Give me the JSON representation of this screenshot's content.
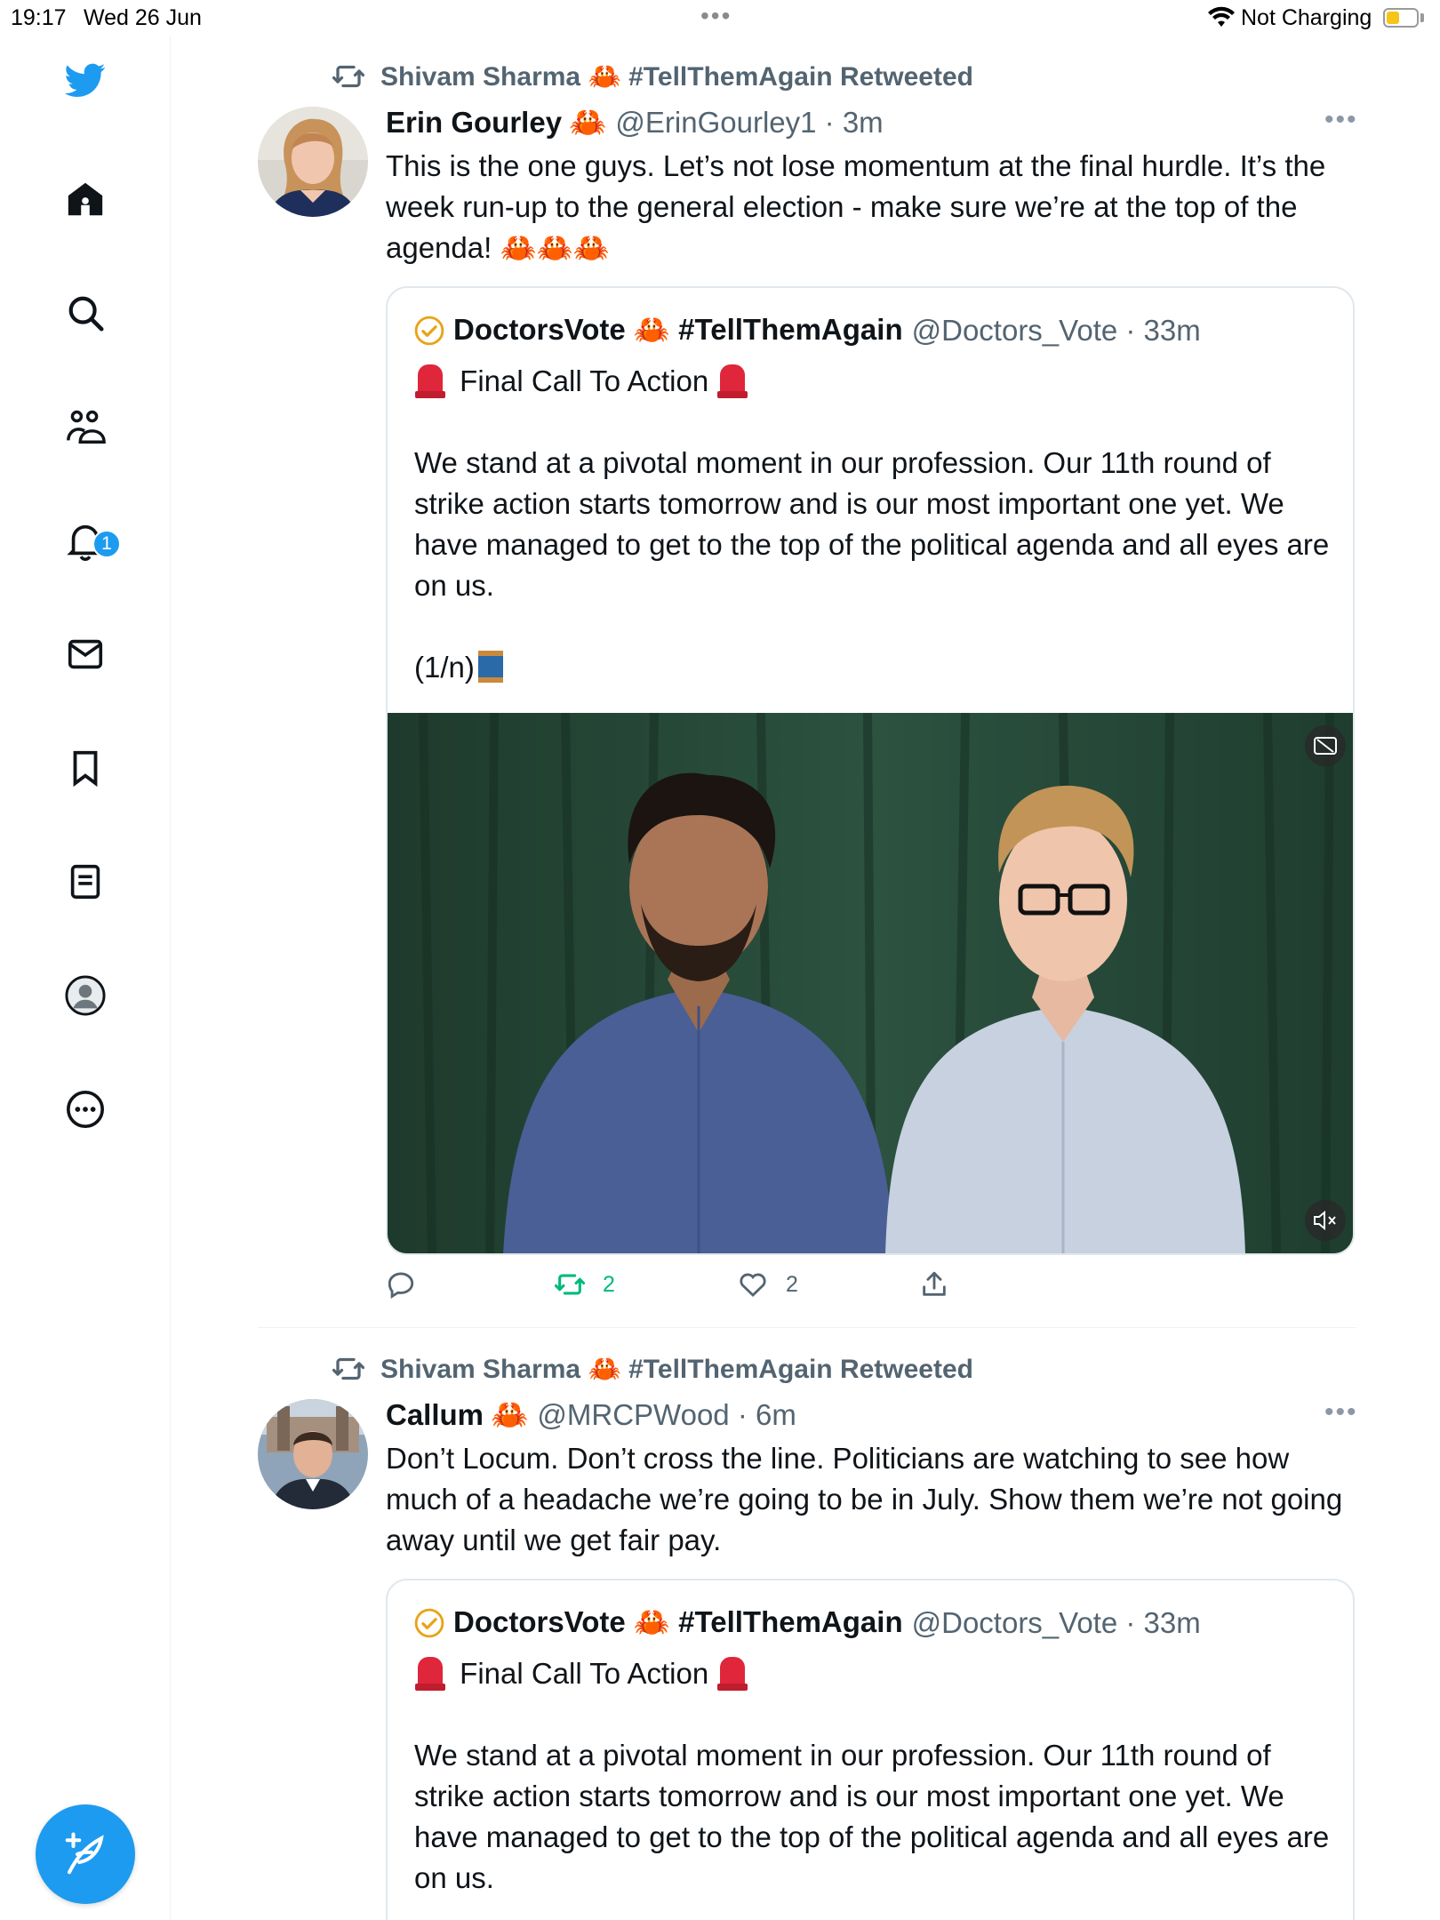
{
  "status_bar": {
    "time": "19:17",
    "date": "Wed 26 Jun",
    "charging": "Not Charging",
    "battery_level": 0.45
  },
  "sidebar": {
    "notification_count": "1",
    "items": [
      {
        "icon": "twitter-bird-icon"
      },
      {
        "icon": "home-icon"
      },
      {
        "icon": "search-icon"
      },
      {
        "icon": "communities-icon"
      },
      {
        "icon": "notifications-bell-icon"
      },
      {
        "icon": "messages-icon"
      },
      {
        "icon": "bookmarks-icon"
      },
      {
        "icon": "lists-icon"
      },
      {
        "icon": "profile-icon"
      },
      {
        "icon": "more-icon"
      }
    ]
  },
  "colors": {
    "brand": "#1d9bf0",
    "retweet_green": "#00ba7c",
    "secondary_text": "#536471"
  },
  "tweets": [
    {
      "retweeted_by": "Shivam Sharma 🦀 #TellThemAgain Retweeted",
      "author_name": "Erin Gourley",
      "author_emoji": "🦀",
      "handle_time": "@ErinGourley1 · 3m",
      "text": "This is the one guys. Let’s not lose momentum at the final hurdle. It’s the week run-up to the general election - make sure we’re at the top of the agenda! 🦀🦀🦀",
      "quote": {
        "name": "DoctorsVote 🦀 #TellThemAgain",
        "handle_time": "@Doctors_Vote · 33m",
        "title": "Final Call To Action",
        "body": "We stand at a pivotal moment in our profession. Our 11th round of strike action starts tomorrow and is our most important one yet. We have managed to get to the top of the political agenda and all eyes are on us.",
        "thread_marker": "(1/n)"
      },
      "actions": {
        "retweets": "2",
        "likes": "2"
      }
    },
    {
      "retweeted_by": "Shivam Sharma 🦀 #TellThemAgain Retweeted",
      "author_name": "Callum",
      "author_emoji": "🦀",
      "handle_time": "@MRCPWood · 6m",
      "text": "Don’t Locum. Don’t cross the line. Politicians are watching to see how much of a headache we’re going to be in July. Show them we’re not going away until we get fair pay.",
      "quote": {
        "name": "DoctorsVote 🦀 #TellThemAgain",
        "handle_time": "@Doctors_Vote · 33m",
        "title": "Final Call To Action",
        "body": "We stand at a pivotal moment in our profession. Our 11th round of strike action starts tomorrow and is our most important one yet. We have managed to get to the top of the political agenda and all eyes are on us."
      }
    }
  ]
}
